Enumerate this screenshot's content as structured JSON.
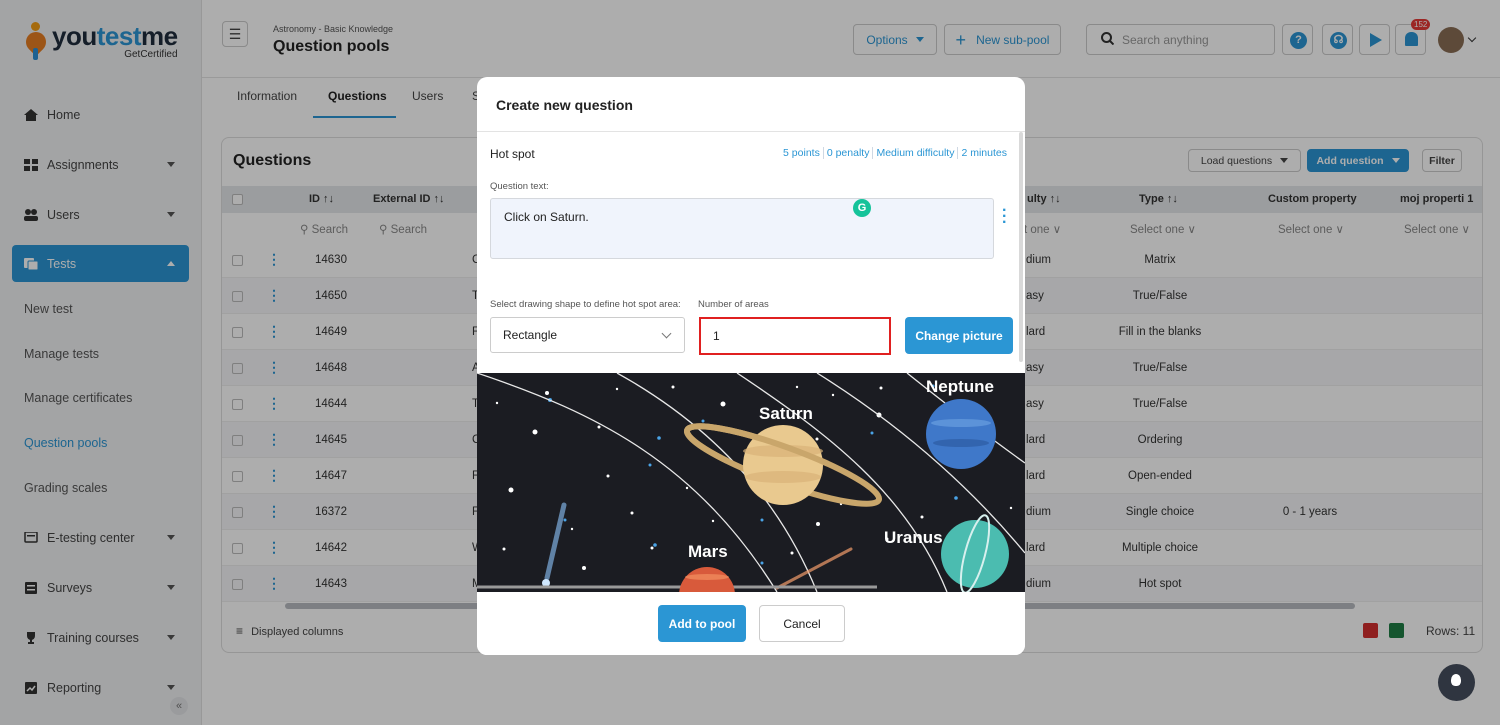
{
  "brand": {
    "name_a": "you",
    "name_b": "test",
    "name_c": "me",
    "tagline": "GetCertified"
  },
  "sidebar": {
    "items": [
      {
        "label": "Home"
      },
      {
        "label": "Assignments"
      },
      {
        "label": "Users"
      },
      {
        "label": "Tests"
      },
      {
        "label": "E-testing center"
      },
      {
        "label": "Surveys"
      },
      {
        "label": "Training courses"
      },
      {
        "label": "Reporting"
      }
    ],
    "sub_items": [
      {
        "label": "New test"
      },
      {
        "label": "Manage tests"
      },
      {
        "label": "Manage certificates"
      },
      {
        "label": "Question pools"
      },
      {
        "label": "Grading scales"
      }
    ],
    "collapse_glyph": "«"
  },
  "header": {
    "breadcrumb": "Astronomy - Basic Knowledge",
    "title": "Question pools",
    "options_label": "Options",
    "new_subpool_label": "New sub-pool",
    "search_placeholder": "Search anything",
    "notification_count": "152"
  },
  "tabs": [
    "Information",
    "Questions",
    "Users",
    "S"
  ],
  "questions": {
    "title": "Questions",
    "load_label": "Load questions",
    "add_label": "Add question",
    "filter_label": "Filter",
    "columns": {
      "id": "ID ↑↓",
      "external": "External ID ↑↓",
      "difficulty": "ulty ↑↓",
      "type": "Type ↑↓",
      "custom": "Custom property",
      "moj": "moj properti 1"
    },
    "filters": {
      "search1": "Search",
      "search2": "Search",
      "diff": "t one ∨",
      "type": "Select one ∨",
      "custom": "Select one ∨",
      "moj": "Select one ∨"
    },
    "rows": [
      {
        "id": "14630",
        "letter": "C",
        "diff": "dium",
        "type": "Matrix",
        "custom": ""
      },
      {
        "id": "14650",
        "letter": "T",
        "diff": "asy",
        "type": "True/False",
        "custom": ""
      },
      {
        "id": "14649",
        "letter": "F",
        "diff": "lard",
        "type": "Fill in the blanks",
        "custom": ""
      },
      {
        "id": "14648",
        "letter": "A",
        "diff": "asy",
        "type": "True/False",
        "custom": ""
      },
      {
        "id": "14644",
        "letter": "T",
        "diff": "asy",
        "type": "True/False",
        "custom": ""
      },
      {
        "id": "14645",
        "letter": "C",
        "diff": "lard",
        "type": "Ordering",
        "custom": ""
      },
      {
        "id": "14647",
        "letter": "F",
        "diff": "lard",
        "type": "Open-ended",
        "custom": ""
      },
      {
        "id": "16372",
        "letter": "F",
        "diff": "dium",
        "type": "Single choice",
        "custom": "0 - 1 years"
      },
      {
        "id": "14642",
        "letter": "W",
        "diff": "lard",
        "type": "Multiple choice",
        "custom": ""
      },
      {
        "id": "14643",
        "letter": "M",
        "diff": "dium",
        "type": "Hot spot",
        "custom": ""
      }
    ],
    "displayed_columns": "Displayed columns",
    "rows_count": "Rows: 11"
  },
  "modal": {
    "title": "Create new question",
    "question_type": "Hot spot",
    "meta": [
      "5 points",
      "0 penalty",
      "Medium difficulty",
      "2 minutes"
    ],
    "question_text_label": "Question text:",
    "question_text": "Click on Saturn.",
    "shape_label": "Select drawing shape to define hot spot area:",
    "shape_value": "Rectangle",
    "areas_label": "Number of areas",
    "areas_value": "1",
    "change_picture": "Change picture",
    "planets": [
      "Neptune",
      "Saturn",
      "Uranus",
      "Mars"
    ],
    "add_label": "Add to pool",
    "cancel_label": "Cancel"
  }
}
